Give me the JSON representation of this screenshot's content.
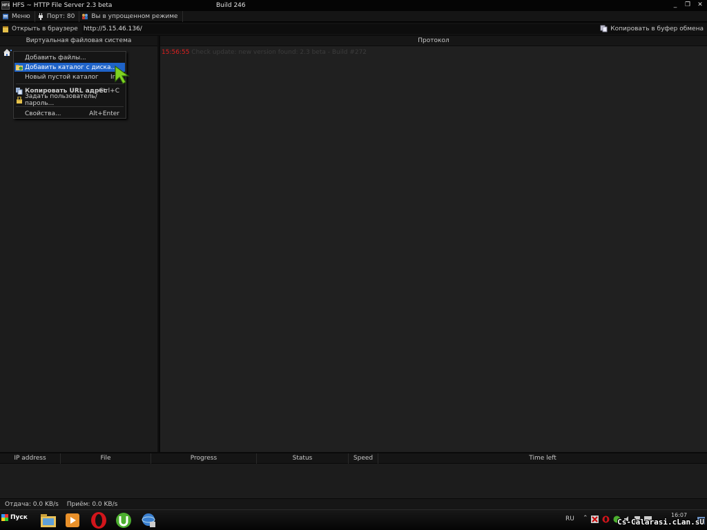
{
  "window": {
    "logo": "HFS",
    "title": "HFS ~ HTTP File Server 2.3 beta",
    "build": "Build 246",
    "controls": [
      "_",
      "❐",
      "✕"
    ]
  },
  "menubar": {
    "menu": "Меню",
    "port": "Порт: 80",
    "mode": "Вы в упрощенном режиме"
  },
  "urlbar": {
    "open_browser": "Открыть в браузере",
    "url": "http://5.15.46.136/",
    "copy_clipboard": "Копировать в буфер обмена"
  },
  "left_panel": {
    "title": "Виртуальная файловая система"
  },
  "right_panel": {
    "title": "Протокол",
    "log": [
      {
        "time": "15:56:55",
        "message": "Check update: new version found: 2.3 beta - Build #272"
      }
    ]
  },
  "context_menu": {
    "items": [
      {
        "label": "Добавить файлы...",
        "shortcut": "",
        "icon": "none",
        "selected": false,
        "bold": false
      },
      {
        "label": "Добавить каталог с диска...",
        "shortcut": "",
        "icon": "folder-add-icon",
        "selected": true,
        "bold": false
      },
      {
        "label": "Новый пустой каталог",
        "shortcut": "Ins",
        "icon": "none",
        "selected": false,
        "bold": false
      },
      {
        "label": "Копировать URL адрес",
        "shortcut": "Ctrl+C",
        "icon": "copy-icon",
        "selected": false,
        "bold": true
      },
      {
        "label": "Задать пользователь/пароль...",
        "shortcut": "",
        "icon": "lock-icon",
        "selected": false,
        "bold": false
      },
      {
        "label": "Свойства...",
        "shortcut": "Alt+Enter",
        "icon": "none",
        "selected": false,
        "bold": false
      }
    ]
  },
  "transfers": {
    "columns": [
      "IP address",
      "File",
      "Progress",
      "Status",
      "Speed",
      "Time left"
    ]
  },
  "status": {
    "upload": "Отдача: 0.0 KB/s",
    "download": "Приём: 0.0 KB/s"
  },
  "taskbar": {
    "start": "Пуск",
    "language": "RU",
    "clock": "16:07",
    "pinned": [
      "explorer-icon",
      "media-player-icon",
      "opera-icon",
      "utorrent-icon",
      "hfs-icon"
    ]
  },
  "watermark": "Cs-Calarasi.cLan.sU",
  "colors": {
    "selection": "#1f63c8",
    "log_time": "#e02020",
    "background": "#1c1c1c"
  }
}
